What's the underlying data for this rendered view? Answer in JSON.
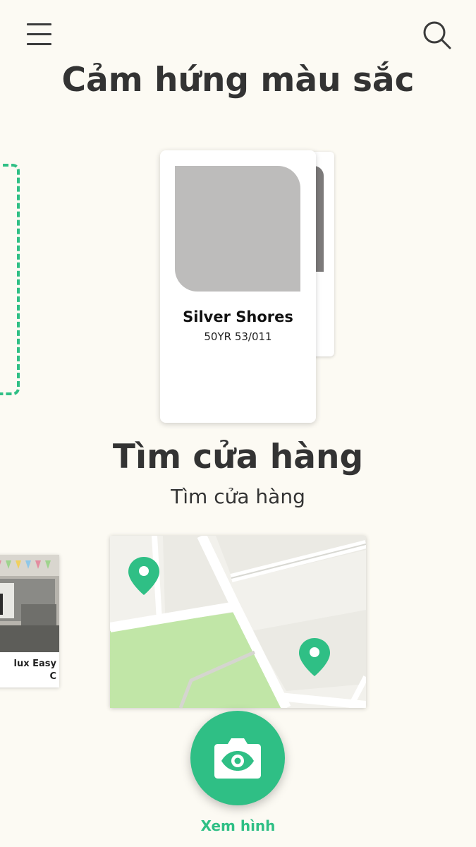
{
  "header": {
    "menu_icon": "menu-icon",
    "search_icon": "search-icon"
  },
  "inspiration": {
    "title": "Cảm hứng màu sắc",
    "card": {
      "name": "Silver Shores",
      "code": "50YR 53/011",
      "swatch_color": "#bdbcbb"
    }
  },
  "product": {
    "label_line1": "lux Easy",
    "label_line2": "C"
  },
  "store": {
    "title": "Tìm cửa hàng",
    "subtitle": "Tìm cửa hàng",
    "pin_icon": "map-pin-icon"
  },
  "camera": {
    "icon": "camera-eye-icon",
    "label": "Xem hình"
  },
  "colors": {
    "accent": "#2fbf85",
    "background": "#fcfaf3",
    "park": "#c1e6a7"
  }
}
